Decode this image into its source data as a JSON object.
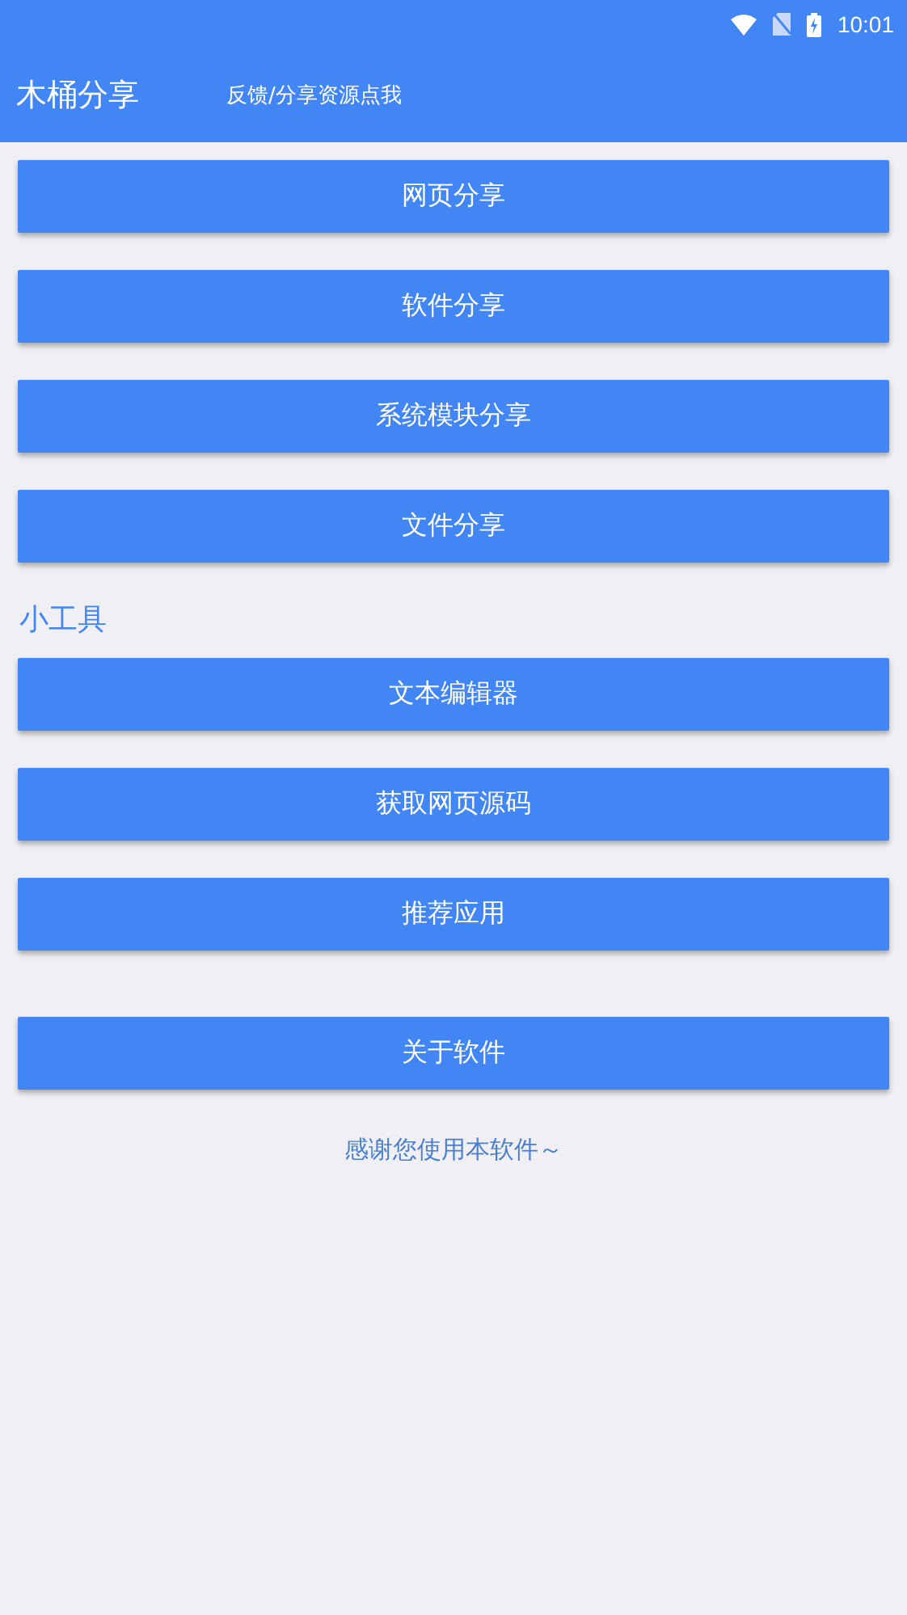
{
  "status_bar": {
    "time": "10:01"
  },
  "app_bar": {
    "title": "木桶分享",
    "action": "反馈/分享资源点我"
  },
  "sections": [
    {
      "buttons": [
        "网页分享",
        "软件分享",
        "系统模块分享",
        "文件分享"
      ]
    },
    {
      "title": "小工具",
      "buttons": [
        "文本编辑器",
        "获取网页源码",
        "推荐应用"
      ]
    },
    {
      "buttons": [
        "关于软件"
      ]
    }
  ],
  "footer": "感谢您使用本软件～"
}
